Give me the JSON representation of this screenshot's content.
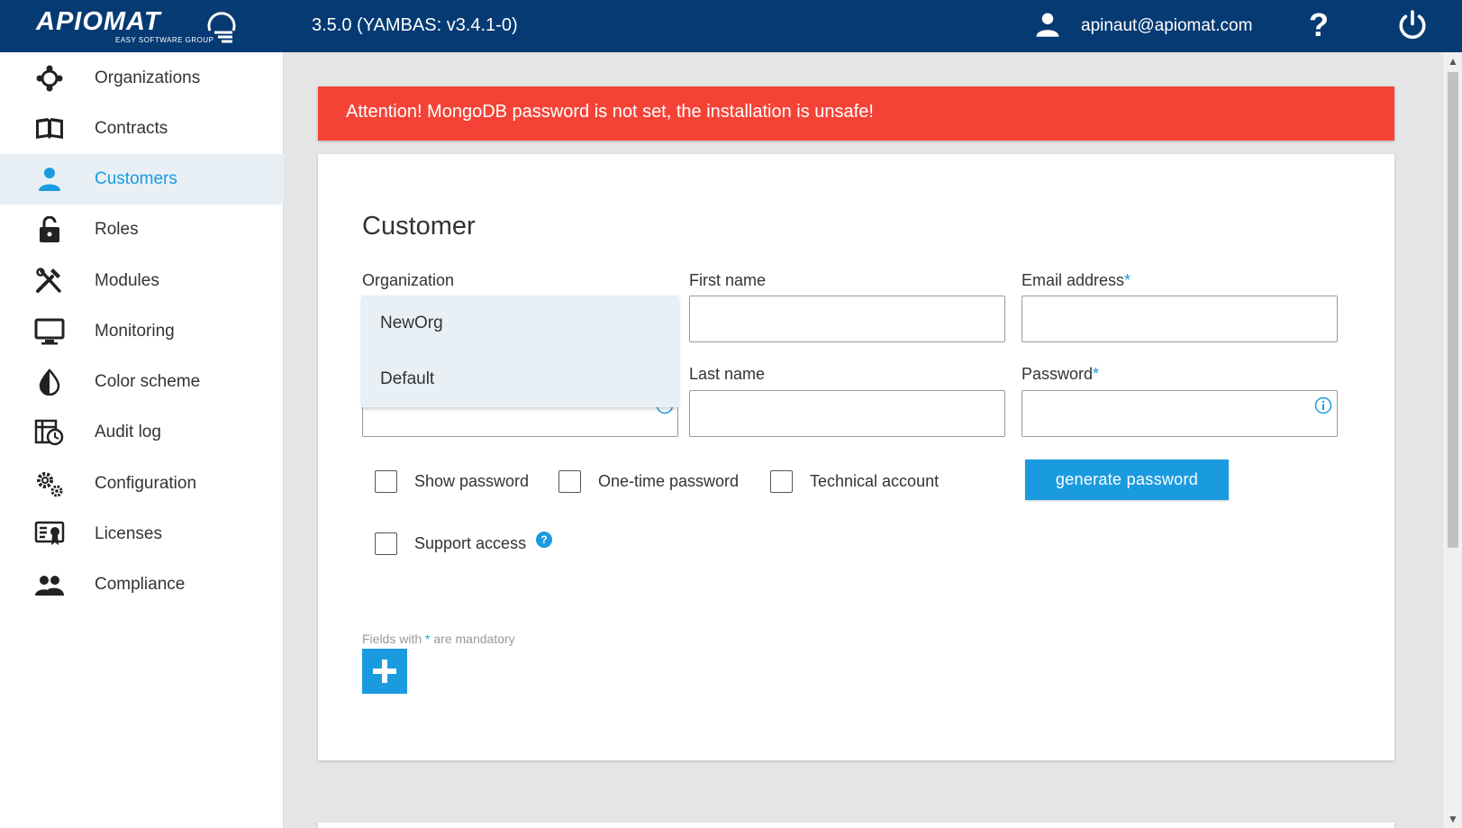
{
  "colors": {
    "primary": "#063a73",
    "accent": "#1a9be0",
    "alert": "#f44336"
  },
  "header": {
    "logo_text": "APIOMAT",
    "logo_sub": "EASY SOFTWARE GROUP",
    "version": "3.5.0 (YAMBAS: v3.4.1-0)",
    "user_email": "apinaut@apiomat.com",
    "help_label": "?"
  },
  "sidebar": {
    "items": [
      {
        "label": "Organizations",
        "icon": "organizations-icon"
      },
      {
        "label": "Contracts",
        "icon": "book-icon"
      },
      {
        "label": "Customers",
        "icon": "person-icon",
        "active": true
      },
      {
        "label": "Roles",
        "icon": "lock-icon"
      },
      {
        "label": "Modules",
        "icon": "tools-icon"
      },
      {
        "label": "Monitoring",
        "icon": "monitor-icon"
      },
      {
        "label": "Color scheme",
        "icon": "drop-icon"
      },
      {
        "label": "Audit log",
        "icon": "audit-log-icon"
      },
      {
        "label": "Configuration",
        "icon": "gears-icon"
      },
      {
        "label": "Licenses",
        "icon": "license-icon"
      },
      {
        "label": "Compliance",
        "icon": "people-icon"
      }
    ]
  },
  "alert": {
    "text": "Attention! MongoDB password is not set, the installation is unsafe!"
  },
  "form": {
    "title": "Customer",
    "organization_label": "Organization",
    "organization_options": [
      "NewOrg",
      "Default"
    ],
    "first_name_label": "First name",
    "first_name_value": "",
    "last_name_label": "Last name",
    "last_name_value": "",
    "email_label": "Email address",
    "email_value": "",
    "password_label": "Password",
    "password_value": "",
    "required_marker": "*",
    "checkboxes": {
      "show_password": "Show password",
      "one_time_password": "One-time password",
      "technical_account": "Technical account",
      "support_access": "Support access"
    },
    "support_help": "?",
    "generate_password_label": "generate password",
    "mandatory_prefix": "Fields with ",
    "mandatory_suffix": " are mandatory"
  }
}
